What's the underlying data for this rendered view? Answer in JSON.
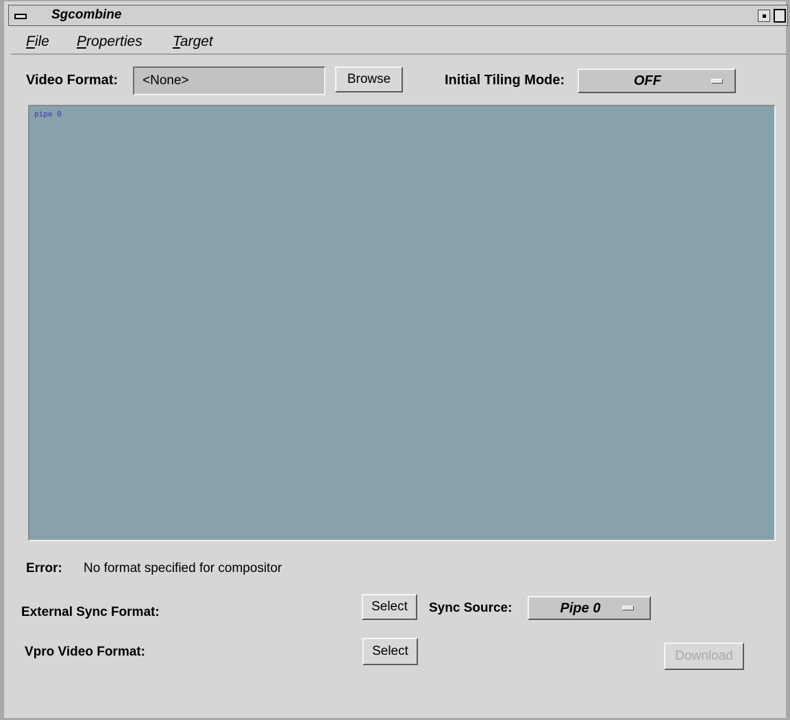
{
  "window": {
    "title": "Sgcombine"
  },
  "menu": {
    "file": {
      "mnemonic": "F",
      "rest": "ile"
    },
    "properties": {
      "mnemonic": "P",
      "rest": "roperties"
    },
    "target": {
      "mnemonic": "T",
      "rest": "arget"
    }
  },
  "video_format": {
    "label": "Video Format:",
    "value": "<None>",
    "browse_label": "Browse"
  },
  "tiling": {
    "label": "Initial Tiling Mode:",
    "value": "OFF"
  },
  "canvas": {
    "pipe_label": "pipe 0",
    "background": "#87a1ad"
  },
  "error": {
    "label": "Error:",
    "message": "No format specified for compositor"
  },
  "external_sync": {
    "label": "External Sync Format:",
    "select_label": "Select"
  },
  "sync_source": {
    "label": "Sync Source:",
    "value": "Pipe 0"
  },
  "vpro": {
    "label": "Vpro Video Format:",
    "select_label": "Select"
  },
  "download": {
    "label": "Download",
    "enabled": false
  }
}
